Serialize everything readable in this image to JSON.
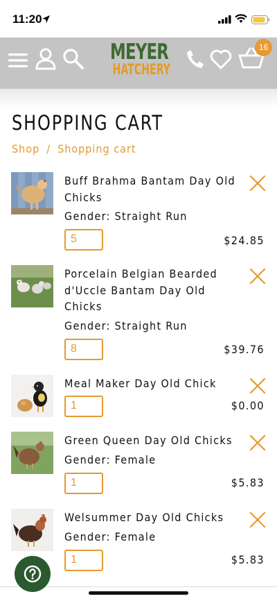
{
  "status_bar": {
    "time": "11:20"
  },
  "header": {
    "logo_line1": "MEYER",
    "logo_line2": "HATCHERY",
    "cart_count": "16",
    "icons": [
      "menu-icon",
      "account-icon",
      "search-icon",
      "phone-icon",
      "heart-icon",
      "basket-icon"
    ]
  },
  "page": {
    "title": "SHOPPING CART",
    "breadcrumb": {
      "shop": "Shop",
      "separator": "/",
      "current": "Shopping cart"
    }
  },
  "colors": {
    "accent": "#e59a30",
    "header_bg": "#c4c4c4",
    "logo_green": "#3e6a32",
    "help_green": "#2a5a2e"
  },
  "cart": {
    "items": [
      {
        "name": "Buff Brahma Bantam Day Old Chicks",
        "gender": "Gender: Straight Run",
        "quantity": "5",
        "price": "$24.85"
      },
      {
        "name": "Porcelain Belgian Bearded d'Uccle Bantam Day Old Chicks",
        "gender": "Gender: Straight Run",
        "quantity": "8",
        "price": "$39.76"
      },
      {
        "name": "Meal Maker Day Old Chick",
        "gender": "",
        "quantity": "1",
        "price": "$0.00"
      },
      {
        "name": "Green Queen Day Old Chicks",
        "gender": "Gender: Female",
        "quantity": "1",
        "price": "$5.83"
      },
      {
        "name": "Welsummer Day Old Chicks",
        "gender": "Gender: Female",
        "quantity": "1",
        "price": "$5.83"
      }
    ]
  }
}
